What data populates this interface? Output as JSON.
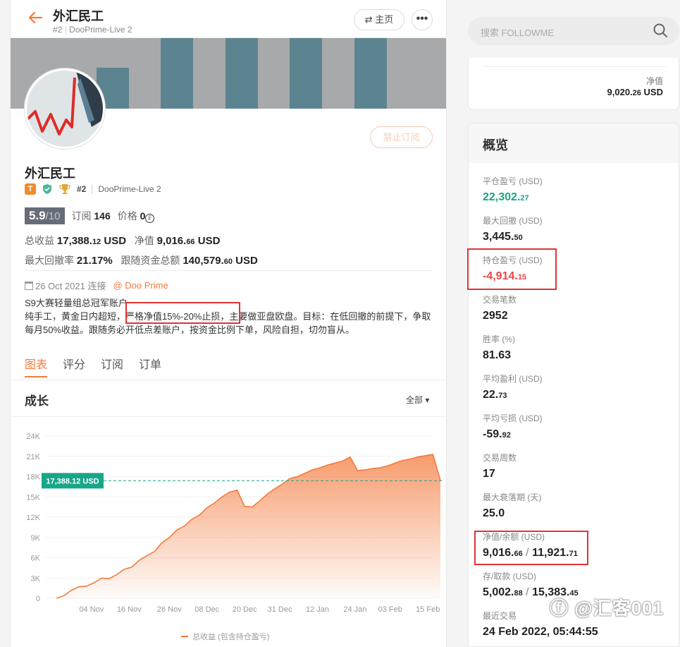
{
  "header": {
    "title": "外汇民工",
    "rank": "#2",
    "account": "DooPrime-Live 2",
    "home_label": "⇄ 主页",
    "more_label": "•••"
  },
  "profile": {
    "ban_label": "禁止订阅",
    "name": "外汇民工",
    "badge_t": "T",
    "rank": "#2",
    "account": "DooPrime-Live 2",
    "score": "5.9",
    "score_den": "/10",
    "subs_label": "订阅",
    "subs": "146",
    "price_label": "价格",
    "price": "0",
    "total_profit_label": "总收益",
    "total_profit_int": "17,388.",
    "total_profit_dec": "12",
    "total_profit_unit": "USD",
    "equity_label": "净值",
    "equity_int": "9,016.",
    "equity_dec": "66",
    "equity_unit": "USD",
    "max_dd_label": "最大回撤率",
    "max_dd": "21.17%",
    "follow_label": "跟随资金总额",
    "follow_int": "140,579.",
    "follow_dec": "60",
    "follow_unit": "USD",
    "join_date": "26 Oct 2021 连接",
    "broker": "@ Doo Prime",
    "desc_line1": "S9大赛轻量组总冠军账户",
    "desc_line2": "纯手工，黄金日内超短，严格净值15%-20%止损，主要做亚盘欧盘。目标：在低回撤的前提下，争取每月50%收益。跟随务必开低点差账户，按资金比例下单，风险自担，切勿盲从。"
  },
  "tabs": [
    {
      "label": "图表"
    },
    {
      "label": "评分"
    },
    {
      "label": "订阅"
    },
    {
      "label": "订单"
    }
  ],
  "growth": {
    "title": "成长",
    "range": "全部 ▾"
  },
  "chart_data": {
    "type": "area",
    "title": "",
    "xlabel": "",
    "ylabel": "",
    "ylim": [
      0,
      24000
    ],
    "yticks": [
      "0",
      "3K",
      "6K",
      "9K",
      "12K",
      "15K",
      "18K",
      "21K",
      "24K"
    ],
    "xticks": [
      "04 Nov",
      "16 Nov",
      "26 Nov",
      "08 Dec",
      "20 Dec",
      "31 Dec",
      "12 Jan",
      "24 Jan",
      "03 Feb",
      "15 Feb"
    ],
    "current_value_label": "17,388.12 USD",
    "current_value": 17388.12,
    "legend": "总收益 (包含持仓盈亏)",
    "color": "#f47a3c",
    "series": [
      {
        "name": "总收益 (包含持仓盈亏)",
        "x": [
          "26 Oct",
          "28 Oct",
          "31 Oct",
          "02 Nov",
          "04 Nov",
          "07 Nov",
          "09 Nov",
          "11 Nov",
          "14 Nov",
          "16 Nov",
          "18 Nov",
          "21 Nov",
          "23 Nov",
          "26 Nov",
          "28 Nov",
          "30 Nov",
          "03 Dec",
          "05 Dec",
          "08 Dec",
          "10 Dec",
          "13 Dec",
          "15 Dec",
          "17 Dec",
          "19 Dec",
          "20 Dec",
          "21 Dec",
          "23 Dec",
          "26 Dec",
          "28 Dec",
          "31 Dec",
          "02 Jan",
          "05 Jan",
          "08 Jan",
          "10 Jan",
          "12 Jan",
          "15 Jan",
          "18 Jan",
          "21 Jan",
          "24 Jan",
          "26 Jan",
          "27 Jan",
          "29 Jan",
          "31 Jan",
          "03 Feb",
          "06 Feb",
          "09 Feb",
          "12 Feb",
          "15 Feb",
          "18 Feb",
          "21 Feb",
          "23 Feb",
          "24 Feb"
        ],
        "values": [
          0,
          400,
          1200,
          1700,
          1800,
          2300,
          3000,
          2900,
          3500,
          4300,
          4600,
          5600,
          6300,
          6900,
          8200,
          9000,
          10100,
          10700,
          11700,
          12300,
          13400,
          14100,
          15000,
          15700,
          16000,
          13600,
          13500,
          14400,
          15400,
          16200,
          16900,
          17700,
          18000,
          18500,
          19000,
          19300,
          19700,
          20000,
          20300,
          20900,
          18900,
          19000,
          19200,
          19300,
          19600,
          20000,
          20400,
          20600,
          20900,
          21100,
          21300,
          17400
        ]
      }
    ]
  },
  "search": {
    "placeholder": "搜索 FOLLOWME"
  },
  "equity_card": {
    "label": "净值",
    "value_int": "9,020.",
    "value_dec": "26",
    "unit": "USD"
  },
  "overview": {
    "title": "概览",
    "stats": [
      {
        "label": "平仓盈亏 (USD)",
        "int": "22,302.",
        "dec": "27",
        "color": "green"
      },
      {
        "label": "最大回撤 (USD)",
        "int": "3,445.",
        "dec": "50",
        "color": ""
      },
      {
        "label": "持仓盈亏 (USD)",
        "int": "-4,914.",
        "dec": "15",
        "color": "red"
      },
      {
        "label": "交易笔数",
        "int": "2952",
        "dec": "",
        "color": ""
      },
      {
        "label": "胜率 (%)",
        "int": "81.63",
        "dec": "",
        "color": ""
      },
      {
        "label": "平均盈利 (USD)",
        "int": "22.",
        "dec": "73",
        "color": ""
      },
      {
        "label": "平均亏损 (USD)",
        "int": "-59.",
        "dec": "92",
        "color": ""
      },
      {
        "label": "交易周数",
        "int": "17",
        "dec": "",
        "color": ""
      },
      {
        "label": "最大衰落期 (天)",
        "int": "25.0",
        "dec": "",
        "color": ""
      },
      {
        "label": "净值/余额 (USD)",
        "int": "9,016.",
        "dec": "66",
        "sep": " / ",
        "int2": "11,921.",
        "dec2": "71",
        "color": ""
      },
      {
        "label": "存/取款 (USD)",
        "int": "5,002.",
        "dec": "88",
        "sep": " / ",
        "int2": "15,383.",
        "dec2": "45",
        "color": ""
      },
      {
        "label": "最近交易",
        "int": "24 Feb 2022, 05:44:55",
        "dec": "",
        "color": ""
      }
    ]
  },
  "watermark": "ⓕ @汇客001",
  "accent_color": "#f47a3c",
  "highlight_color": "#e23333"
}
